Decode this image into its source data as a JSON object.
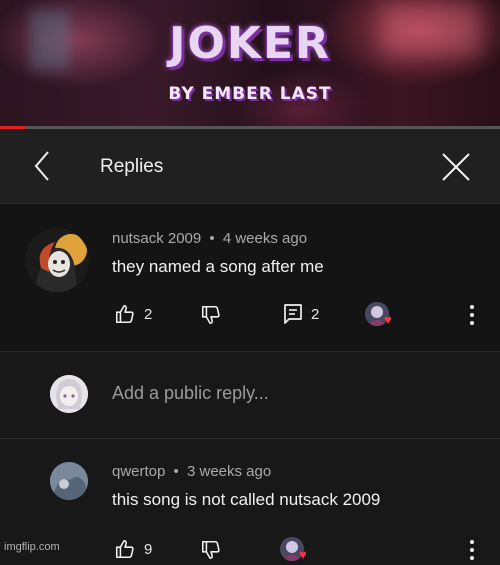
{
  "video": {
    "title": "JOKER",
    "subtitle": "BY EMBER LAST",
    "progress_fraction": 0.05
  },
  "header": {
    "title": "Replies",
    "back_icon": "chevron-left-icon",
    "close_icon": "close-icon"
  },
  "comments": [
    {
      "author": "nutsack 2009",
      "separator": "•",
      "time": "4 weeks ago",
      "text": "they named a song after me",
      "likes": "2",
      "replies": "2",
      "hearted": true
    },
    {
      "author": "qwertop",
      "separator": "•",
      "time": "3 weeks ago",
      "text": "this song is not called nutsack 2009",
      "likes": "9",
      "hearted": true
    }
  ],
  "reply_box": {
    "placeholder": "Add a public reply..."
  },
  "watermark": "imgflip.com",
  "colors": {
    "background": "#181818",
    "highlight_comment": "#141414",
    "progress": "#e51e1e",
    "heart": "#ff3344",
    "title_purple": "#7a2fa0"
  }
}
